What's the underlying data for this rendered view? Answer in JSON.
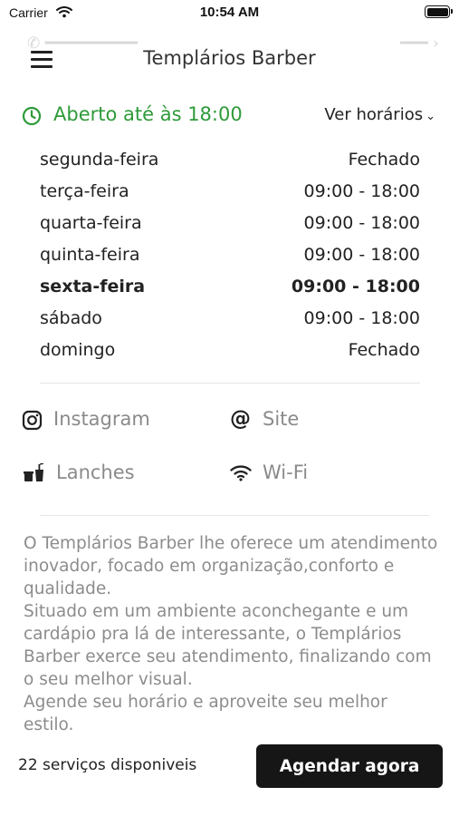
{
  "status_bar": {
    "carrier": "Carrier",
    "time": "10:54 AM"
  },
  "header": {
    "title": "Templários Barber"
  },
  "open_status": {
    "text": "Aberto até às 18:00",
    "toggle_label": "Ver horários",
    "color": "#2e9a3a"
  },
  "hours": [
    {
      "day": "segunda-feira",
      "time": "Fechado",
      "today": false
    },
    {
      "day": "terça-feira",
      "time": "09:00 - 18:00",
      "today": false
    },
    {
      "day": "quarta-feira",
      "time": "09:00 - 18:00",
      "today": false
    },
    {
      "day": "quinta-feira",
      "time": "09:00 - 18:00",
      "today": false
    },
    {
      "day": "sexta-feira",
      "time": "09:00 - 18:00",
      "today": true
    },
    {
      "day": "sábado",
      "time": "09:00 - 18:00",
      "today": false
    },
    {
      "day": "domingo",
      "time": "Fechado",
      "today": false
    }
  ],
  "features": [
    {
      "label": "Instagram",
      "icon": "instagram-icon"
    },
    {
      "label": "Site",
      "icon": "at-icon"
    },
    {
      "label": "Lanches",
      "icon": "snacks-icon"
    },
    {
      "label": "Wi-Fi",
      "icon": "wifi-icon"
    }
  ],
  "description": [
    "O Templários Barber lhe oferece um atendimento inovador, focado em organização,conforto e qualidade.",
    "Situado em um ambiente aconchegante e um cardápio pra lá de interessante, o Templários Barber exerce seu atendimento, finalizando com o seu melhor visual.",
    "Agende seu horário e aproveite seu melhor estilo."
  ],
  "footer": {
    "services_count": "22 serviços disponiveis",
    "cta_label": "Agendar agora"
  }
}
